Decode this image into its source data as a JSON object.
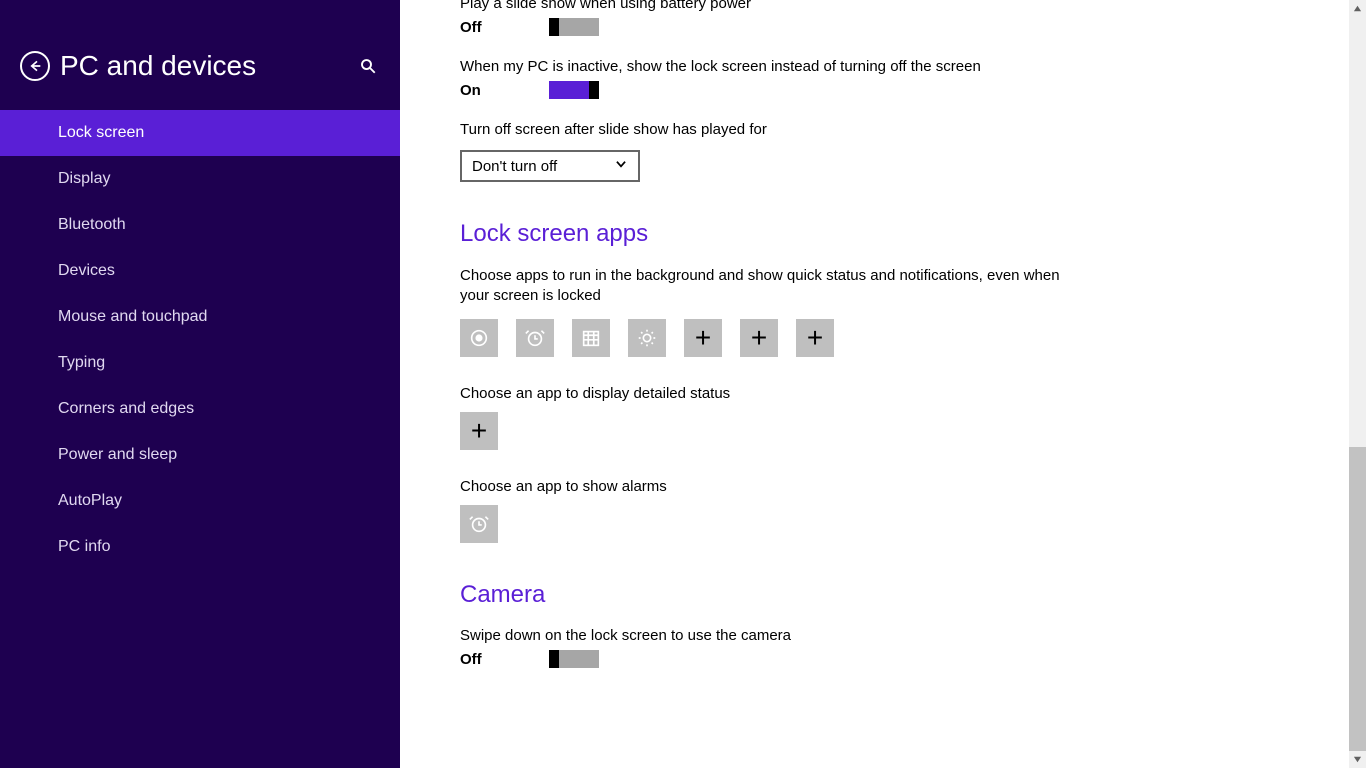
{
  "header": {
    "title": "PC and devices"
  },
  "sidebar": {
    "items": [
      {
        "label": "Lock screen",
        "selected": true
      },
      {
        "label": "Display"
      },
      {
        "label": "Bluetooth"
      },
      {
        "label": "Devices"
      },
      {
        "label": "Mouse and touchpad"
      },
      {
        "label": "Typing"
      },
      {
        "label": "Corners and edges"
      },
      {
        "label": "Power and sleep"
      },
      {
        "label": "AutoPlay"
      },
      {
        "label": "PC info"
      }
    ]
  },
  "settings": {
    "slideshow_battery": {
      "label": "Play a slide show when using battery power",
      "state": "Off"
    },
    "inactive_lock": {
      "label": "When my PC is inactive, show the lock screen instead of turning off the screen",
      "state": "On"
    },
    "turnoff_after": {
      "label": "Turn off screen after slide show has played for",
      "value": "Don't turn off"
    }
  },
  "lockapps": {
    "title": "Lock screen apps",
    "desc": "Choose apps to run in the background and show quick status and notifications, even when your screen is locked",
    "detailed_label": "Choose an app to display detailed status",
    "alarms_label": "Choose an app to show alarms"
  },
  "camera": {
    "title": "Camera",
    "swipe": {
      "label": "Swipe down on the lock screen to use the camera",
      "state": "Off"
    }
  },
  "icons": {
    "plus": "+"
  }
}
